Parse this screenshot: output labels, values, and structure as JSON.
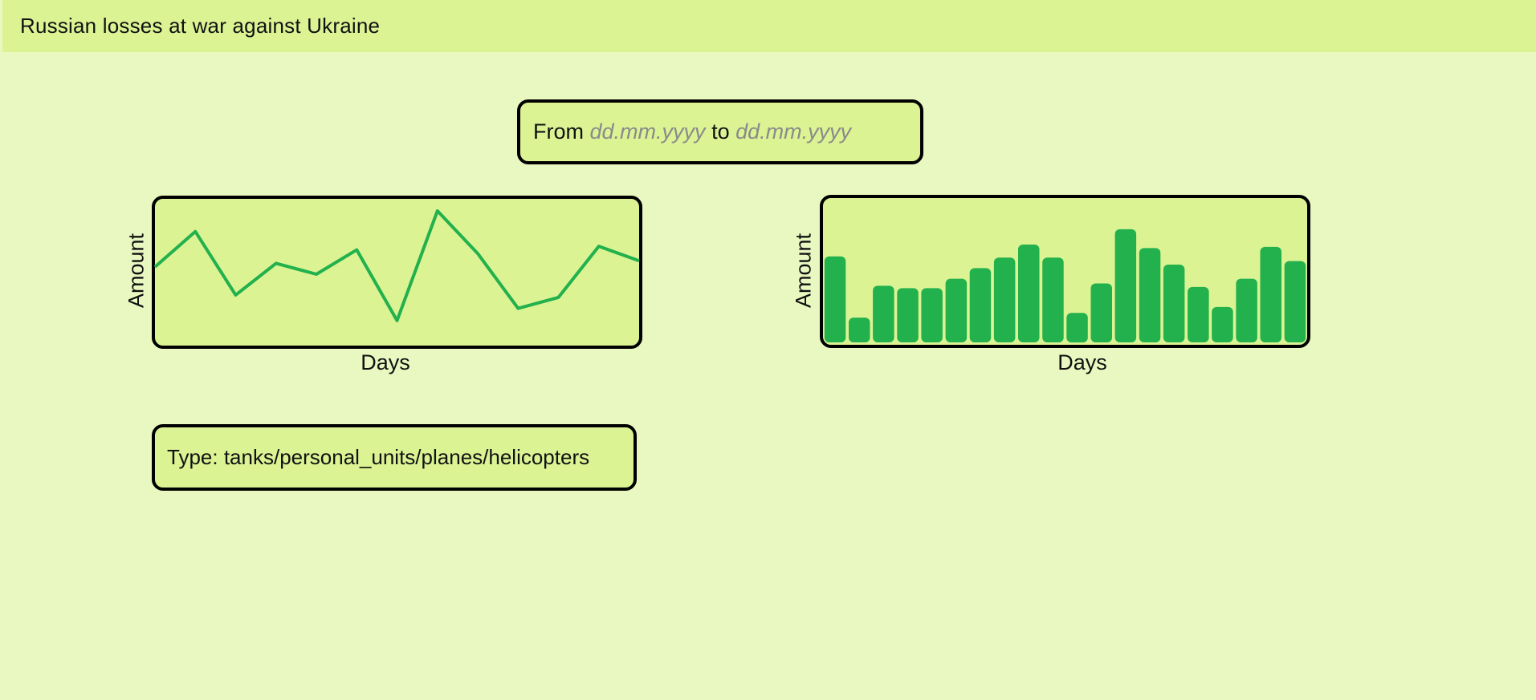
{
  "header": {
    "title": "Russian losses at war against Ukraine"
  },
  "date_range": {
    "from_label": "From",
    "from_placeholder": "dd.mm.yyyy",
    "to_label": "to",
    "to_placeholder": "dd.mm.yyyy"
  },
  "type_selector": {
    "label": "Type:",
    "value": "tanks/personal_units/planes/helicopters"
  },
  "colors": {
    "page_background": "#e9f8c0",
    "panel_background": "#dcf394",
    "series": "#22b14c",
    "border": "#000000",
    "placeholder": "#8a8a8a"
  },
  "chart_data": [
    {
      "type": "line",
      "xlabel": "Days",
      "ylabel": "Amount",
      "series": [
        {
          "values": [
            5.4,
            8.3,
            3.1,
            5.7,
            4.8,
            6.8,
            1.0,
            10.0,
            6.5,
            2.0,
            2.9,
            7.1,
            5.9
          ]
        }
      ]
    },
    {
      "type": "bar",
      "xlabel": "Days",
      "ylabel": "Amount",
      "series": [
        {
          "values": [
            7.3,
            2.1,
            4.8,
            4.6,
            4.6,
            5.4,
            6.3,
            7.2,
            8.3,
            7.2,
            2.5,
            5.0,
            9.6,
            8.0,
            6.6,
            4.7,
            3.0,
            5.4,
            8.1,
            6.9
          ]
        }
      ]
    }
  ]
}
